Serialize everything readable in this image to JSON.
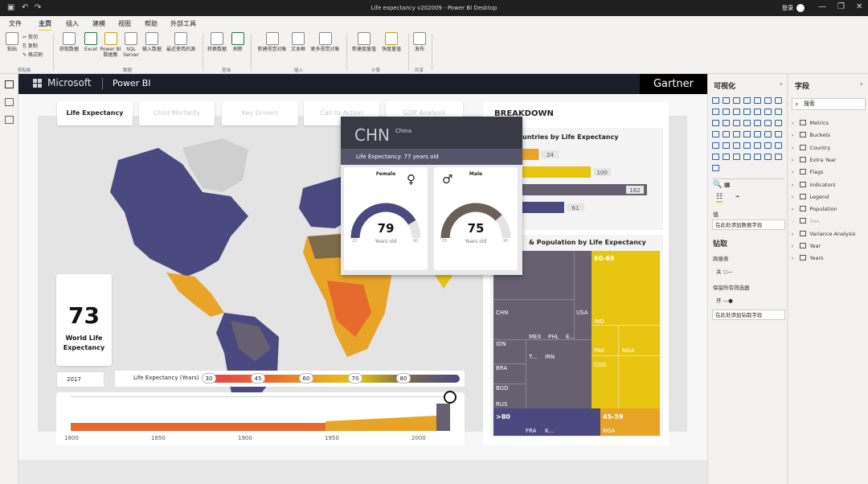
{
  "window": {
    "title": "Life expectancy v202009 - Power BI Desktop",
    "login": "登录"
  },
  "menu": {
    "items": [
      "文件",
      "主页",
      "插入",
      "建模",
      "视图",
      "帮助",
      "外部工具"
    ],
    "active": "主页"
  },
  "ribbon": {
    "paste": "粘贴",
    "cut": "剪切",
    "copy": "复制",
    "format_painter": "格式刷",
    "clipboard_group": "剪贴板",
    "get_data": "获取数据",
    "excel": "Excel",
    "pbi_dataset_1": "Power BI",
    "pbi_dataset_2": "数据集",
    "sql_1": "SQL",
    "sql_2": "Server",
    "enter_data": "输入数据",
    "recent_sources": "最近使用的源",
    "data_group": "数据",
    "transform": "转换数据",
    "refresh": "刷新",
    "query_group": "查询",
    "new_visual": "新建视觉对象",
    "text_box": "文本框",
    "more_visuals": "更多视觉对象",
    "insert_group": "插入",
    "new_measure": "新建度量值",
    "quick_measure": "快度量值",
    "calc_group": "计算",
    "publish": "发布",
    "share_group": "共享"
  },
  "report": {
    "brand_ms": "Microsoft",
    "brand_pbi": "Power BI",
    "brand_gartner": "Gartner",
    "tabs": [
      "Life Expectancy",
      "Child Mortality",
      "Key Drivers",
      "Call to Action",
      "GDP Analysis"
    ],
    "kpi_value": "73",
    "kpi_label": "World Life Expectancy",
    "year": "2017",
    "legend_label": "Life Expectancy (Years)",
    "legend_stops": [
      "30",
      "45",
      "60",
      "70",
      "80"
    ],
    "timeline_ticks": [
      "1800",
      "1850",
      "1900",
      "1950",
      "2000"
    ],
    "breakdown_title": "BREAKDOWN",
    "bar_title": "Countries by Life Expectancy",
    "bar_title_visible": "untries by Life Expectancy",
    "treemap_title_visible": "& Population by Life Expectancy",
    "colors": {
      "navy": "#4a4a80",
      "yellow": "#e8c510",
      "orange": "#e7a427",
      "gray": "#666070",
      "dark": "#1a1e29"
    }
  },
  "chart_data": [
    {
      "type": "bar",
      "title": "Countries by Life Expectancy",
      "values": [
        24,
        100,
        182,
        61
      ],
      "colors": [
        "#e7a427",
        "#e8c510",
        "#666070",
        "#4a4a80"
      ]
    },
    {
      "type": "treemap",
      "title": "& Population by Life Expectancy",
      "groups": [
        {
          "name": "",
          "color": "#666070",
          "labels": [
            "CHN",
            "USA",
            "MEX",
            "PHL",
            "E...",
            "IDN",
            "T...",
            "IRN",
            "BRA",
            "BGD",
            "RUS"
          ]
        },
        {
          "name": "60-69",
          "color": "#e8c510",
          "labels": [
            "IND",
            "PAK",
            "NGA",
            "COD"
          ]
        },
        {
          "name": ">80",
          "color": "#4a4a80",
          "labels": [
            "FRA",
            "K..."
          ]
        },
        {
          "name": "45-59",
          "color": "#e7a427",
          "labels": [
            "NGA"
          ]
        }
      ]
    }
  ],
  "popup": {
    "code": "CHN",
    "country": "China",
    "life_expectancy": "Life Expectancy: 77 years old",
    "female_label": "Female",
    "female_value": "79",
    "male_label": "Male",
    "male_value": "75",
    "unit": "Years old",
    "min": "25",
    "max": "90",
    "female_fraction": 0.83,
    "male_fraction": 0.77
  },
  "viz_pane": {
    "title": "可视化",
    "values_label": "值",
    "add_data_field": "在此处添加数据字段",
    "drill_title": "钻取",
    "cross_report": "跨报表",
    "off": "关",
    "keep_filters": "保留所有筛选器",
    "on": "开",
    "add_drill_field": "在此处添加钻取字段"
  },
  "fields_pane": {
    "title": "字段",
    "search_placeholder": "搜索",
    "tables": [
      "Metrics",
      "Buckets",
      "Country",
      "Extra Year",
      "Flags",
      "Indicators",
      "Legend",
      "Population",
      "Sex",
      "Variance Analysis",
      "Year",
      "Years"
    ]
  }
}
